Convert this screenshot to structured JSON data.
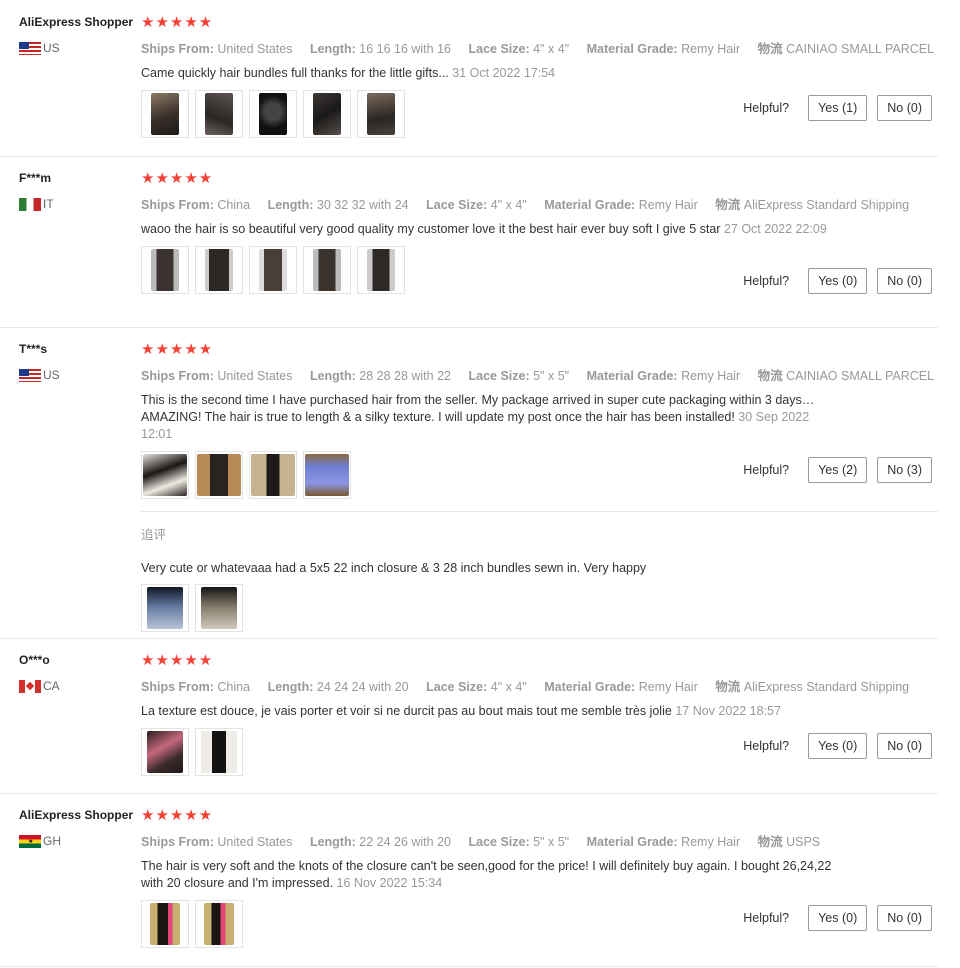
{
  "labels": {
    "ships_from": "Ships From:",
    "length": "Length:",
    "lace_size": "Lace Size:",
    "material_grade": "Material Grade:",
    "logistics": "物流",
    "helpful": "Helpful?",
    "additional_review": "追评"
  },
  "reviews": [
    {
      "user": "AliExpress Shopper",
      "country": "US",
      "rating": 5,
      "stars": "★★★★★",
      "ships_from": "United States",
      "length": "16 16 16 with 16",
      "lace_size": "4\" x 4\"",
      "material_grade": "Remy Hair",
      "logistics": "CAINIAO SMALL PARCEL",
      "text": "Came quickly hair bundles full thanks for the little gifts...",
      "date": "31 Oct 2022 17:54",
      "photo_count": 5,
      "yes": "Yes (1)",
      "no": "No (0)"
    },
    {
      "user": "F***m",
      "country": "IT",
      "rating": 5,
      "stars": "★★★★★",
      "ships_from": "China",
      "length": "30 32 32 with 24",
      "lace_size": "4\" x 4\"",
      "material_grade": "Remy Hair",
      "logistics": "AliExpress Standard Shipping",
      "text": "waoo the hair is so beautiful very good quality my customer love it the best hair ever buy soft I give 5 star",
      "date": "27 Oct 2022 22:09",
      "photo_count": 5,
      "yes": "Yes (0)",
      "no": "No (0)"
    },
    {
      "user": "T***s",
      "country": "US",
      "rating": 5,
      "stars": "★★★★★",
      "ships_from": "United States",
      "length": "28 28 28 with 22",
      "lace_size": "5\" x 5\"",
      "material_grade": "Remy Hair",
      "logistics": "CAINIAO SMALL PARCEL",
      "text": "This is the second time I have purchased hair from the seller. My package arrived in super cute packaging within 3 days…AMAZING! The hair is true to length & a silky texture. I will update my post once the hair has been installed!",
      "date": "30 Sep 2022 12:01",
      "photo_count": 4,
      "yes": "Yes (2)",
      "no": "No (3)",
      "additional_text": "Very cute or whatevaaa had a 5x5 22 inch closure & 3 28 inch bundles sewn in. Very happy",
      "additional_photo_count": 2
    },
    {
      "user": "O***o",
      "country": "CA",
      "rating": 5,
      "stars": "★★★★★",
      "ships_from": "China",
      "length": "24 24 24 with 20",
      "lace_size": "4\" x 4\"",
      "material_grade": "Remy Hair",
      "logistics": "AliExpress Standard Shipping",
      "text": "La texture est douce, je vais porter et voir si ne durcit pas au bout mais tout me semble très jolie",
      "date": "17 Nov 2022 18:57",
      "photo_count": 2,
      "yes": "Yes (0)",
      "no": "No (0)"
    },
    {
      "user": "AliExpress Shopper",
      "country": "GH",
      "rating": 5,
      "stars": "★★★★★",
      "ships_from": "United States",
      "length": "22 24 26 with 20",
      "lace_size": "5\" x 5\"",
      "material_grade": "Remy Hair",
      "logistics": "USPS",
      "text": "The hair is very soft and the knots of the closure can't be seen,good for the price! I will definitely buy again. I bought 26,24,22 with 20 closure and I'm impressed.",
      "date": "16 Nov 2022 15:34",
      "photo_count": 2,
      "yes": "Yes (0)",
      "no": "No (0)"
    }
  ],
  "colors": {
    "star": "#f44336",
    "meta": "#999999",
    "text": "#333333",
    "border": "#e8e8e8"
  }
}
